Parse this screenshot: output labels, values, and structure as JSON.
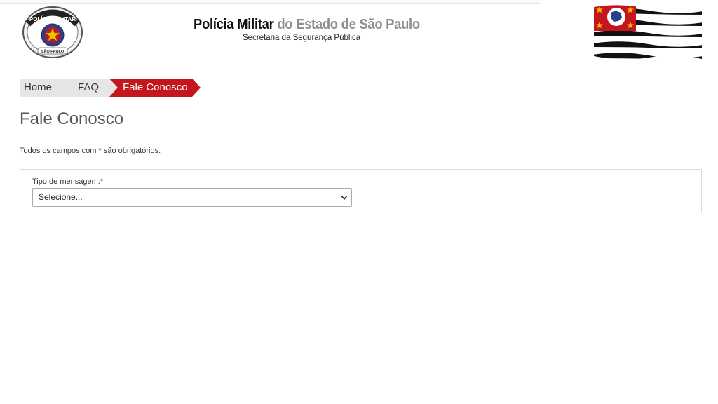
{
  "header": {
    "title_bold": "Polícia Militar",
    "title_light": " do Estado de São Paulo",
    "subtitle": "Secretaria da Segurança Pública",
    "badge_text_top": "POLÍCIA MILITAR",
    "badge_text_bottom": "SÃO PAULO",
    "badge_icon": "pm-sp-badge-icon",
    "flag_icon": "sao-paulo-flag-icon"
  },
  "breadcrumb": {
    "items": [
      {
        "label": "Home"
      },
      {
        "label": "FAQ"
      },
      {
        "label": "Fale Conosco"
      }
    ],
    "active_color": "#c4161c",
    "inactive_color": "#e6e6e6"
  },
  "page": {
    "title": "Fale Conosco",
    "required_note_before": "Todos os campos com ",
    "required_star": "*",
    "required_note_after": " são obrigatórios."
  },
  "form": {
    "message_type_label": "Tipo de mensagem:",
    "message_type_required": "*",
    "message_type_value": "Selecione..."
  }
}
